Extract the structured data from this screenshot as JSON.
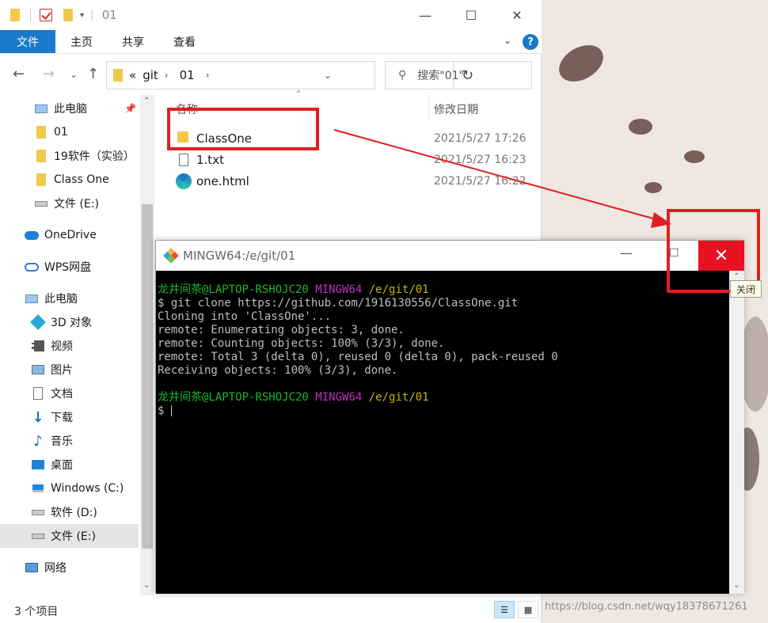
{
  "explorer": {
    "title": "01",
    "ribbon_tabs": [
      "文件",
      "主页",
      "共享",
      "查看"
    ],
    "help": "?",
    "address": {
      "sep": "«",
      "crumbs": [
        "git",
        "01"
      ]
    },
    "search_placeholder": "搜索\"01\"",
    "sidebar": [
      {
        "label": "此电脑",
        "icon": "pc-icon",
        "pinned": true
      },
      {
        "label": "01",
        "icon": "folder-icon"
      },
      {
        "label": "19软件（实验）",
        "icon": "folder-icon"
      },
      {
        "label": "Class One",
        "icon": "folder-icon"
      },
      {
        "label": "文件 (E:)",
        "icon": "drive-icon"
      },
      {
        "label": "OneDrive",
        "icon": "cloud-icon"
      },
      {
        "label": "WPS网盘",
        "icon": "cloud-outline-icon"
      },
      {
        "label": "此电脑",
        "icon": "pc-icon"
      },
      {
        "label": "3D 对象",
        "icon": "cube-icon"
      },
      {
        "label": "视频",
        "icon": "video-icon"
      },
      {
        "label": "图片",
        "icon": "picture-icon"
      },
      {
        "label": "文档",
        "icon": "document-icon"
      },
      {
        "label": "下载",
        "icon": "download-icon"
      },
      {
        "label": "音乐",
        "icon": "music-icon"
      },
      {
        "label": "桌面",
        "icon": "desktop-icon"
      },
      {
        "label": "Windows (C:)",
        "icon": "windows-drive-icon"
      },
      {
        "label": "软件 (D:)",
        "icon": "drive-icon"
      },
      {
        "label": "文件 (E:)",
        "icon": "drive-icon",
        "selected": true
      },
      {
        "label": "网络",
        "icon": "network-icon"
      }
    ],
    "columns": {
      "name": "名称",
      "date": "修改日期"
    },
    "files": [
      {
        "name": "ClassOne",
        "date": "2021/5/27 17:26",
        "icon": "folder-icon"
      },
      {
        "name": "1.txt",
        "date": "2021/5/27 16:23",
        "icon": "text-file-icon"
      },
      {
        "name": "one.html",
        "date": "2021/5/27 16:22",
        "icon": "edge-icon"
      }
    ],
    "status": "3 个项目"
  },
  "terminal": {
    "title": "MINGW64:/e/git/01",
    "prompt_user": "龙井间茶@LAPTOP-RSHOJC20",
    "prompt_env": "MINGW64",
    "prompt_path": "/e/git/01",
    "lines": [
      "$ git clone https://github.com/1916130556/ClassOne.git",
      "Cloning into 'ClassOne'...",
      "remote: Enumerating objects: 3, done.",
      "remote: Counting objects: 100% (3/3), done.",
      "remote: Total 3 (delta 0), reused 0 (delta 0), pack-reused 0",
      "Receiving objects: 100% (3/3), done."
    ],
    "final_prompt": "$"
  },
  "tooltip": "关闭",
  "watermark": "https://blog.csdn.net/wqy18378671261",
  "colors": {
    "accent": "#1979ca",
    "annotation_red": "#e02020",
    "close_red": "#e81123"
  }
}
